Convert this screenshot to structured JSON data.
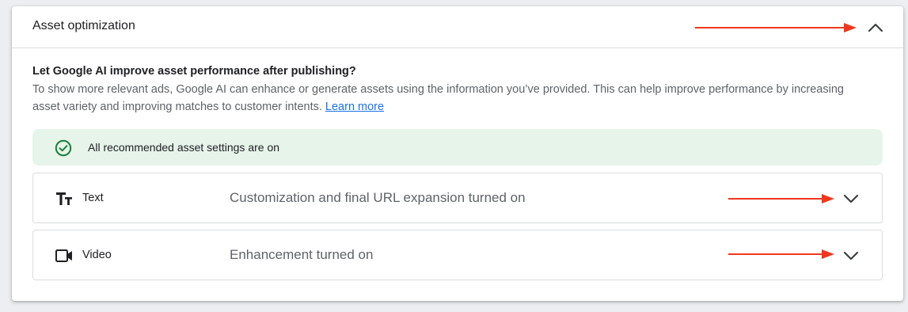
{
  "panel": {
    "title": "Asset optimization",
    "collapse_icon": "chevron-up-icon"
  },
  "intro": {
    "question": "Let Google AI improve asset performance after publishing?",
    "description": "To show more relevant ads, Google AI can enhance or generate assets using the information you’ve provided. This can help improve performance by increasing asset variety and improving matches to customer intents. ",
    "learn_more": "Learn more"
  },
  "banner": {
    "icon": "check-circle-icon",
    "text": "All recommended asset settings are on"
  },
  "assets": [
    {
      "icon": "text-format-icon",
      "label": "Text",
      "status": "Customization and final URL expansion turned on",
      "expand_icon": "chevron-down-icon"
    },
    {
      "icon": "video-camera-icon",
      "label": "Video",
      "status": "Enhancement turned on",
      "expand_icon": "chevron-down-icon"
    }
  ],
  "colors": {
    "accent": "#1a73e8",
    "success": "#188038",
    "banner_bg": "#e6f4ea",
    "annotation_arrow": "#f0371e"
  }
}
